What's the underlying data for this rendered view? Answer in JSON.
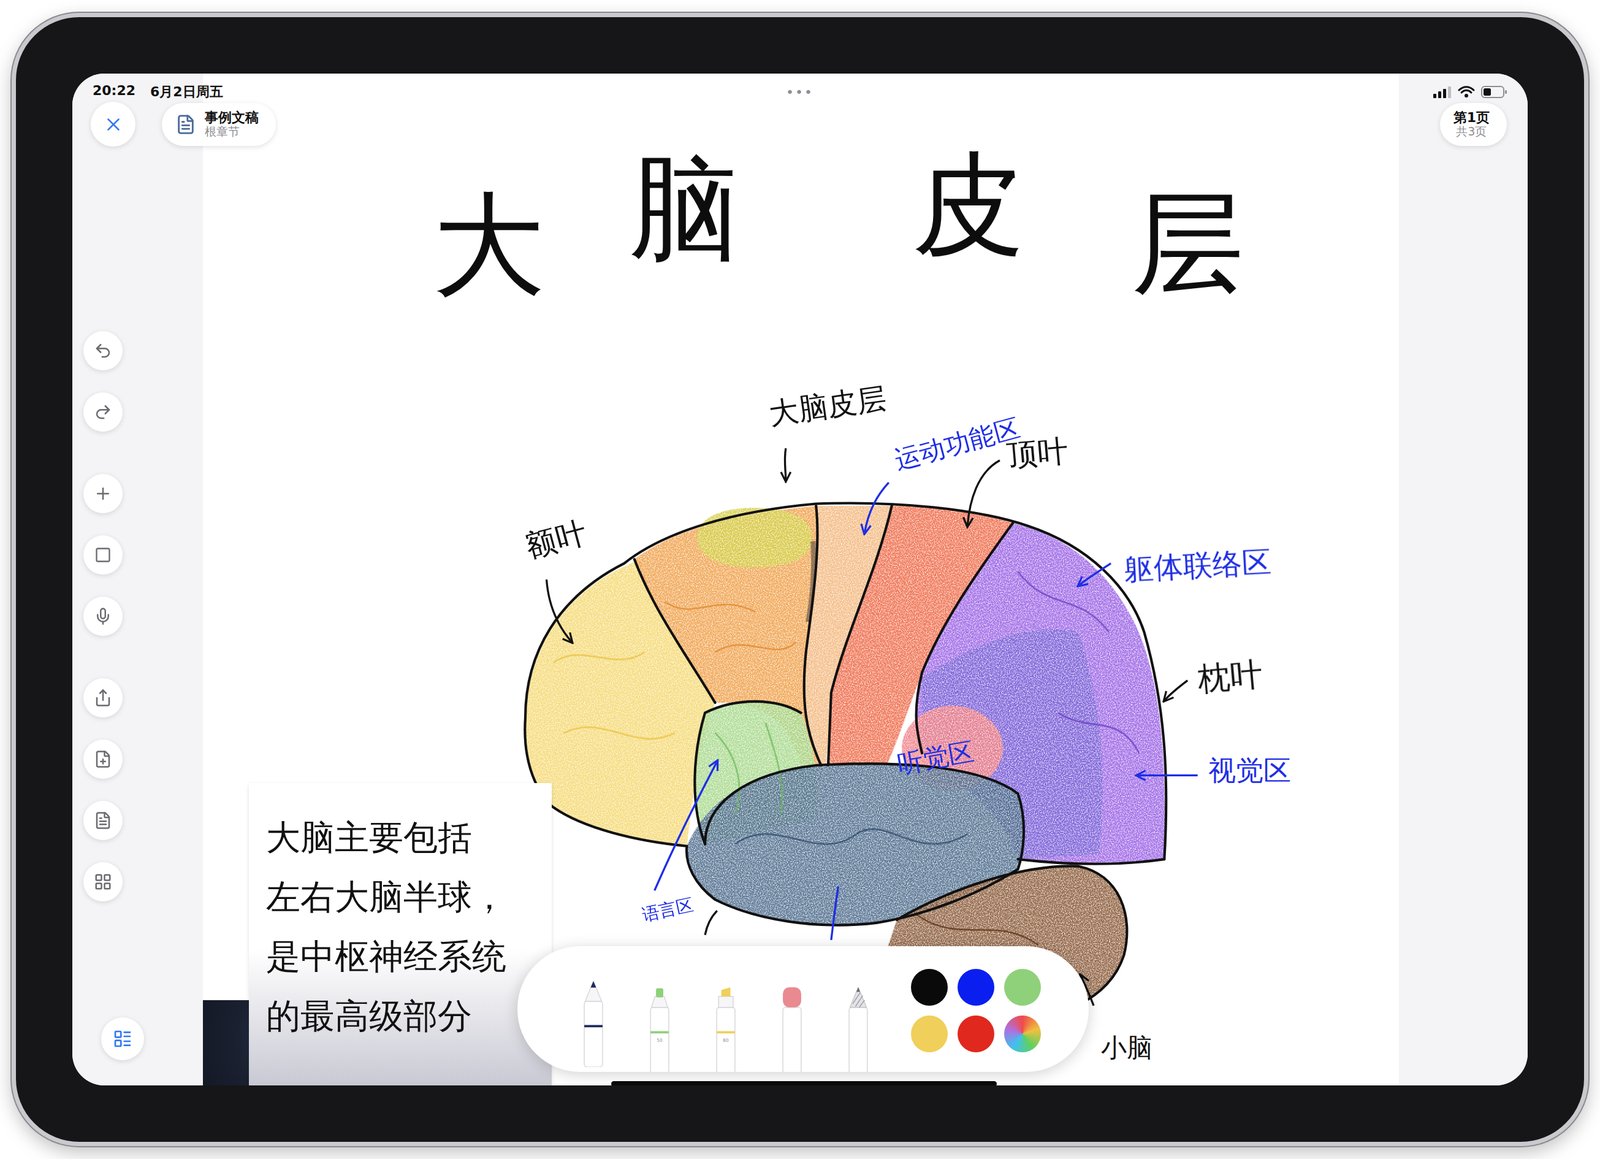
{
  "status_bar": {
    "time": "20:22",
    "date": "6月2日周五",
    "handle": "•••"
  },
  "document": {
    "title": "事例文稿",
    "section": "根章节"
  },
  "page_indicator": {
    "current": "第1页",
    "total": "共3页"
  },
  "canvas": {
    "title": "大脑皮层",
    "labels": [
      {
        "text": "大脑皮层",
        "color": "#111111"
      },
      {
        "text": "运动功能区",
        "color": "#1f2ee6"
      },
      {
        "text": "顶叶",
        "color": "#111111"
      },
      {
        "text": "额叶",
        "color": "#111111"
      },
      {
        "text": "躯体联络区",
        "color": "#1f2ee6"
      },
      {
        "text": "枕叶",
        "color": "#111111"
      },
      {
        "text": "听觉区",
        "color": "#1f2ee6"
      },
      {
        "text": "视觉区",
        "color": "#1f2ee6"
      },
      {
        "text": "语言区",
        "color": "#1f2ee6"
      },
      {
        "text": "小脑",
        "color": "#111111"
      }
    ],
    "note": {
      "lines": [
        "大脑主要包括",
        "左右大脑半球，",
        "是中枢神经系统",
        "的最高级部分"
      ]
    }
  },
  "palette": {
    "tools": [
      {
        "kind": "pen",
        "selected": true
      },
      {
        "kind": "marker",
        "label": "50",
        "selected": false
      },
      {
        "kind": "highlighter",
        "label": "80",
        "selected": false
      },
      {
        "kind": "eraser",
        "selected": false
      },
      {
        "kind": "pencil",
        "selected": false
      }
    ],
    "colors": [
      {
        "kind": "swatch",
        "color": "#0a0a0a",
        "selected": false
      },
      {
        "kind": "swatch",
        "color": "#0a1ef0",
        "selected": false
      },
      {
        "kind": "swatch",
        "color": "#8fd17a",
        "selected": false
      },
      {
        "kind": "swatch",
        "color": "#f0cf5a",
        "selected": false
      },
      {
        "kind": "swatch",
        "color": "#e0281e",
        "selected": false
      },
      {
        "kind": "picker",
        "color": "#b070e0",
        "selected": false
      }
    ]
  }
}
